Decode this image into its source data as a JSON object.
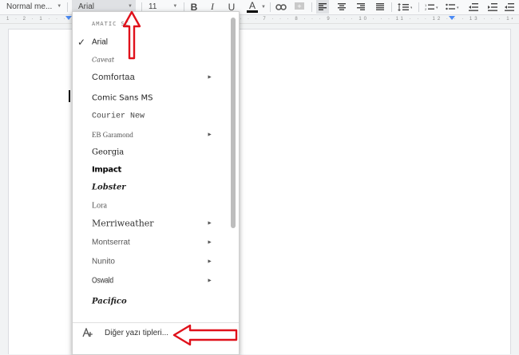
{
  "toolbar": {
    "style_label": "Normal me...",
    "font_label": "Arial",
    "size_label": "11",
    "bold": "B",
    "italic": "I",
    "underline": "U",
    "text_color": "A"
  },
  "font_menu": {
    "items": [
      {
        "label": "AMATIC SC",
        "has_submenu": false,
        "checked": false
      },
      {
        "label": "Arial",
        "has_submenu": false,
        "checked": true
      },
      {
        "label": "Caveat",
        "has_submenu": false,
        "checked": false
      },
      {
        "label": "Comfortaa",
        "has_submenu": true,
        "checked": false
      },
      {
        "label": "Comic Sans MS",
        "has_submenu": false,
        "checked": false
      },
      {
        "label": "Courier New",
        "has_submenu": false,
        "checked": false
      },
      {
        "label": "EB Garamond",
        "has_submenu": true,
        "checked": false
      },
      {
        "label": "Georgia",
        "has_submenu": false,
        "checked": false
      },
      {
        "label": "Impact",
        "has_submenu": false,
        "checked": false
      },
      {
        "label": "Lobster",
        "has_submenu": false,
        "checked": false
      },
      {
        "label": "Lora",
        "has_submenu": false,
        "checked": false
      },
      {
        "label": "Merriweather",
        "has_submenu": true,
        "checked": false
      },
      {
        "label": "Montserrat",
        "has_submenu": true,
        "checked": false
      },
      {
        "label": "Nunito",
        "has_submenu": true,
        "checked": false
      },
      {
        "label": "Oswald",
        "has_submenu": true,
        "checked": false
      },
      {
        "label": "Pacifico",
        "has_submenu": false,
        "checked": false
      }
    ],
    "more_fonts_label": "Diğer yazı tipleri...",
    "more_fonts_icon": "font-add-icon",
    "submenu_glyph": "►",
    "check_glyph": "✓"
  },
  "ruler": {
    "marks": "1 · 2 · 1 · · · 1 · · · 2 · · · 3 · · · 4 · · · 5 · · · 6 · · · 7 · · · 8 · · · 9 · · · 10 · · · 11 · · · 12 · · · 13 · · · 14 · · · 15 · · · 16 · · · 17 · · · 18"
  },
  "colors": {
    "annotation_red": "#e0111b",
    "menu_bg": "#ffffff",
    "toolbar_bg": "#f8f9fa"
  }
}
